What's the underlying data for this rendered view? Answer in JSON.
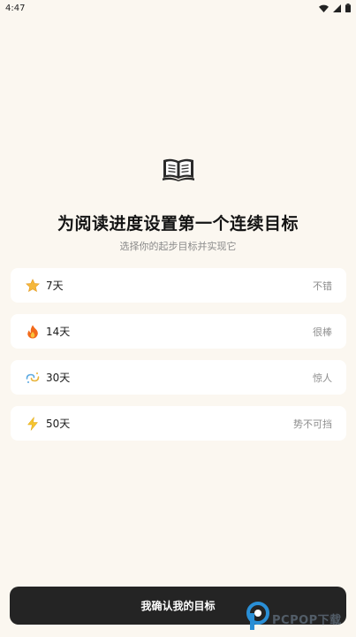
{
  "status_bar": {
    "time": "4:47"
  },
  "header": {
    "title": "为阅读进度设置第一个连续目标",
    "subtitle": "选择你的起步目标并实现它"
  },
  "options": [
    {
      "days": "7天",
      "tag": "不错",
      "icon": "star-icon"
    },
    {
      "days": "14天",
      "tag": "很棒",
      "icon": "fire-icon"
    },
    {
      "days": "30天",
      "tag": "惊人",
      "icon": "sparkle-swirl-icon"
    },
    {
      "days": "50天",
      "tag": "势不可挡",
      "icon": "lightning-icon"
    }
  ],
  "confirm_label": "我确认我的目标",
  "watermark": {
    "text": "PCPOP下载",
    "logo": "pcpop-logo"
  },
  "colors": {
    "background": "#fbf7f0",
    "card": "#ffffff",
    "button": "#242424"
  }
}
